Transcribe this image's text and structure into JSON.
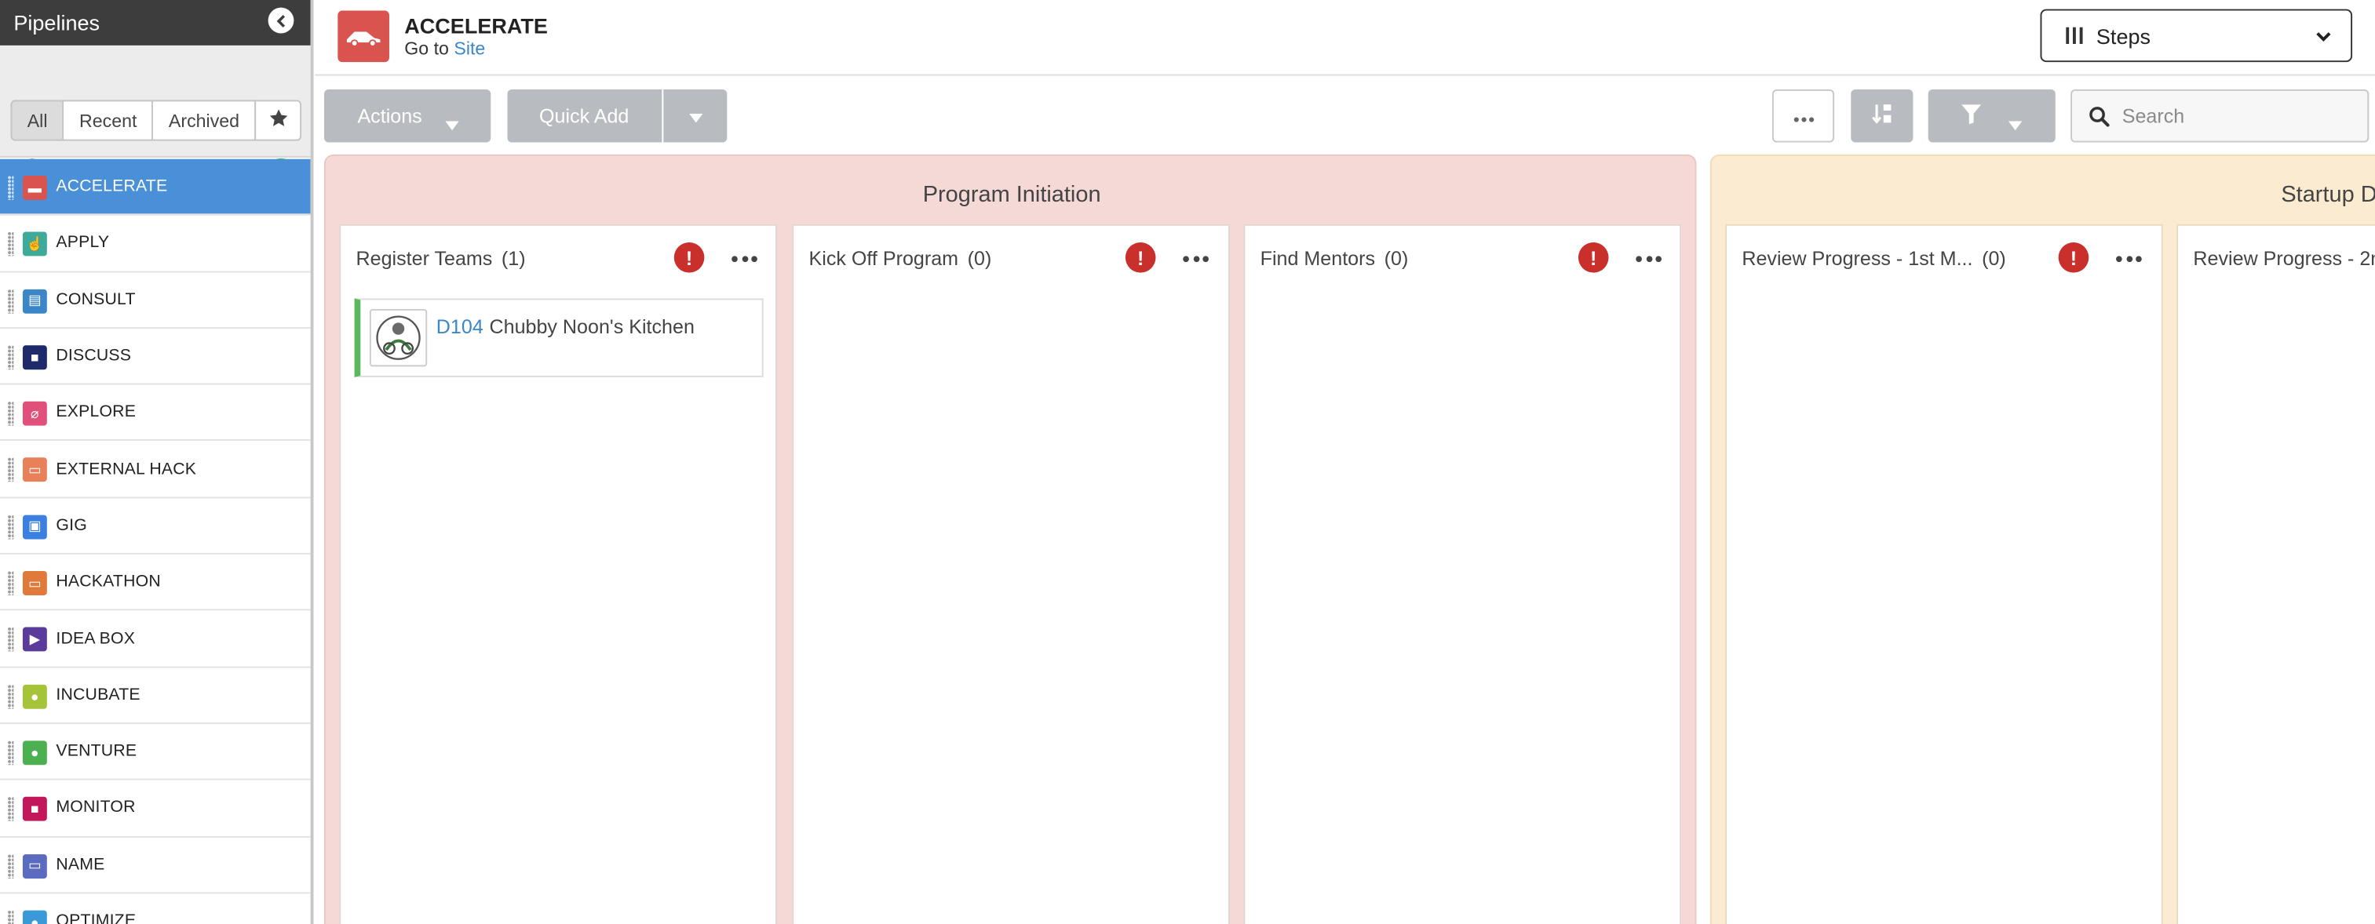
{
  "sidebar": {
    "title": "Pipelines",
    "filters": [
      "All",
      "Recent",
      "Archived"
    ],
    "active_filter": "All",
    "items": [
      {
        "label": "ACCELERATE",
        "color": "#d9534f",
        "icon": "car-icon",
        "glyph": "▬",
        "active": true
      },
      {
        "label": "APPLY",
        "color": "#3fa99a",
        "icon": "hand-pointer-icon",
        "glyph": "☝"
      },
      {
        "label": "CONSULT",
        "color": "#3a86c8",
        "icon": "document-icon",
        "glyph": "▤"
      },
      {
        "label": "DISCUSS",
        "color": "#1f2a6b",
        "icon": "chat-bubbles-icon",
        "glyph": "■"
      },
      {
        "label": "EXPLORE",
        "color": "#e0507a",
        "icon": "compass-icon",
        "glyph": "⌀"
      },
      {
        "label": "EXTERNAL HACK",
        "color": "#e8805a",
        "icon": "laptop-icon",
        "glyph": "▭"
      },
      {
        "label": "GIG",
        "color": "#3b7fe0",
        "icon": "briefcase-icon",
        "glyph": "▣"
      },
      {
        "label": "HACKATHON",
        "color": "#e07a3a",
        "icon": "laptop-icon",
        "glyph": "▭"
      },
      {
        "label": "IDEA BOX",
        "color": "#5a3a9a",
        "icon": "megaphone-icon",
        "glyph": "▶"
      },
      {
        "label": "INCUBATE",
        "color": "#a6c43a",
        "icon": "egg-icon",
        "glyph": "●"
      },
      {
        "label": "VENTURE",
        "color": "#4caf50",
        "icon": "money-bag-icon",
        "glyph": "●"
      },
      {
        "label": "MONITOR",
        "color": "#c2185b",
        "icon": "binoculars-icon",
        "glyph": "■"
      },
      {
        "label": "NAME",
        "color": "#5b6bc0",
        "icon": "tag-icon",
        "glyph": "▭"
      },
      {
        "label": "OPTIMIZE",
        "color": "#3a9ad9",
        "icon": "gauge-icon",
        "glyph": "●"
      }
    ]
  },
  "header": {
    "title": "ACCELERATE",
    "go_to": "Go to",
    "site_link": "Site",
    "view_select": "Steps"
  },
  "toolbar": {
    "actions_label": "Actions",
    "quick_add_label": "Quick Add",
    "search_placeholder": "Search"
  },
  "board": {
    "stages": [
      {
        "title": "Program Initiation",
        "columns": [
          {
            "title": "Register Teams",
            "count": "(1)"
          },
          {
            "title": "Kick Off Program",
            "count": "(0)"
          },
          {
            "title": "Find Mentors",
            "count": "(0)"
          }
        ]
      },
      {
        "title": "Startup D",
        "columns": [
          {
            "title": "Review Progress - 1st M...",
            "count": "(0)"
          },
          {
            "title": "Review Progress - 2n",
            "count": ""
          }
        ]
      }
    ],
    "card": {
      "id": "D104",
      "name": "Chubby Noon's Kitchen"
    }
  }
}
